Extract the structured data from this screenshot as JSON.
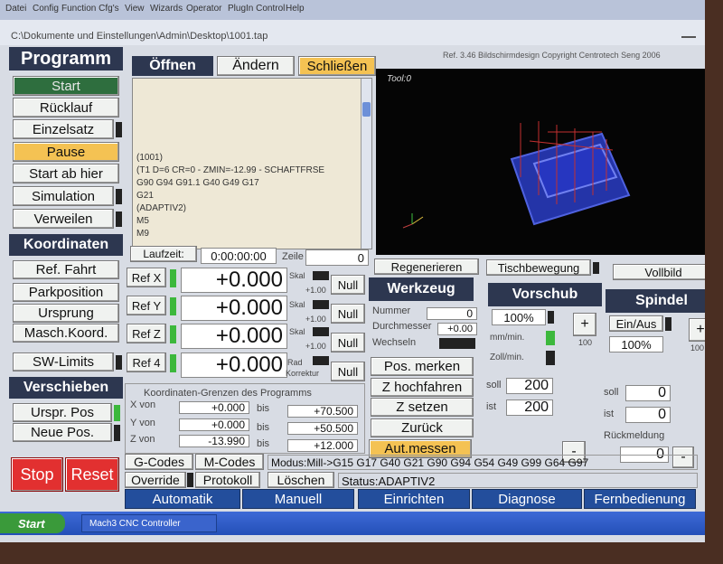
{
  "menu": [
    "Datei",
    "Config",
    "Function Cfg's",
    "View",
    "Wizards",
    "Operator",
    "PlugIn Control",
    "Help"
  ],
  "window_title": "C:\\Dokumente und Einstellungen\\Admin\\Desktop\\1001.tap",
  "header_ref": "Ref. 3.46 Bildschirmdesign Copyright Centrotech Seng 2006",
  "program": {
    "title": "Programm",
    "buttons": [
      "Start",
      "Rücklauf",
      "Einzelsatz",
      "Pause",
      "Start ab hier",
      "Simulation",
      "Verweilen"
    ]
  },
  "file_tabs": {
    "open": "Öffnen",
    "edit": "Ändern",
    "close": "Schließen"
  },
  "code_lines": [
    "(1001)",
    "(T1 D=6 CR=0 - ZMIN=-12.99 - SCHAFTFRSE",
    "G90 G94 G91.1 G40 G49 G17",
    "G21",
    "(ADAPTIV2)",
    "M5",
    "M9"
  ],
  "toolpath_label": "Tool:0",
  "runtime": {
    "label": "Laufzeit:",
    "value": "0:00:00:00",
    "line_label": "Zeile",
    "line_value": "0"
  },
  "coordinates": {
    "title": "Koordinaten",
    "buttons": [
      "Ref. Fahrt",
      "Parkposition",
      "Ursprung",
      "Masch.Koord."
    ],
    "sw_limits": "SW-Limits"
  },
  "axes": [
    {
      "ref": "Ref X",
      "value": "+0.000",
      "skal": "Skal",
      "skal_val": "+1.00",
      "null": "Null"
    },
    {
      "ref": "Ref Y",
      "value": "+0.000",
      "skal": "Skal",
      "skal_val": "+1.00",
      "null": "Null"
    },
    {
      "ref": "Ref Z",
      "value": "+0.000",
      "skal": "Skal",
      "skal_val": "+1.00",
      "null": "Null"
    },
    {
      "ref": "Ref 4",
      "value": "+0.000",
      "skal": "Rad",
      "skal_val": "Korrektur",
      "null": "Null"
    }
  ],
  "shift": {
    "title": "Verschieben",
    "buttons": [
      "Urspr. Pos",
      "Neue Pos."
    ]
  },
  "limits": {
    "title": "Koordinaten-Grenzen des Programms",
    "rows": [
      {
        "label": "X von",
        "from": "+0.000",
        "bis": "bis",
        "to": "+70.500"
      },
      {
        "label": "Y von",
        "from": "+0.000",
        "bis": "bis",
        "to": "+50.500"
      },
      {
        "label": "Z von",
        "from": "-13.990",
        "bis": "bis",
        "to": "+12.000"
      }
    ]
  },
  "toolbar_right": {
    "regen": "Regenerieren",
    "table": "Tischbewegung",
    "full": "Vollbild"
  },
  "werkzeug": {
    "title": "Werkzeug",
    "nummer_label": "Nummer",
    "nummer": "0",
    "durchmesser_label": "Durchmesser",
    "durchmesser": "+0.00",
    "wechseln_label": "Wechseln",
    "buttons": [
      "Pos. merken",
      "Z hochfahren",
      "Z setzen",
      "Zurück",
      "Aut.messen"
    ]
  },
  "vorschub": {
    "title": "Vorschub",
    "percent": "100%",
    "plus": "+",
    "scale": "100",
    "mm_min": "mm/min.",
    "zoll_min": "Zoll/min.",
    "soll_label": "soll",
    "soll": "200",
    "ist_label": "ist",
    "ist": "200",
    "minus": "-"
  },
  "spindel": {
    "title": "Spindel",
    "toggle": "Ein/Aus",
    "percent": "100%",
    "plus": "+",
    "scale": "100",
    "soll_label": "soll",
    "soll": "0",
    "ist_label": "ist",
    "ist": "0",
    "feedback_label": "Rückmeldung",
    "feedback": "0",
    "minus": "-"
  },
  "actions": {
    "stop": "Stop",
    "reset": "Reset"
  },
  "codes": {
    "gcodes": "G-Codes",
    "mcodes": "M-Codes",
    "override": "Override",
    "protokoll": "Protokoll",
    "loeschen": "Löschen",
    "modus": "Modus:Mill->G15  G17 G40 G21 G90 G94 G54 G49 G99 G64 G97",
    "status": "Status:ADAPTIV2"
  },
  "tabs": [
    "Automatik",
    "Manuell",
    "Einrichten",
    "Diagnose",
    "Fernbedienung"
  ],
  "taskbar": {
    "start": "Start",
    "app": "Mach3 CNC Controller"
  }
}
